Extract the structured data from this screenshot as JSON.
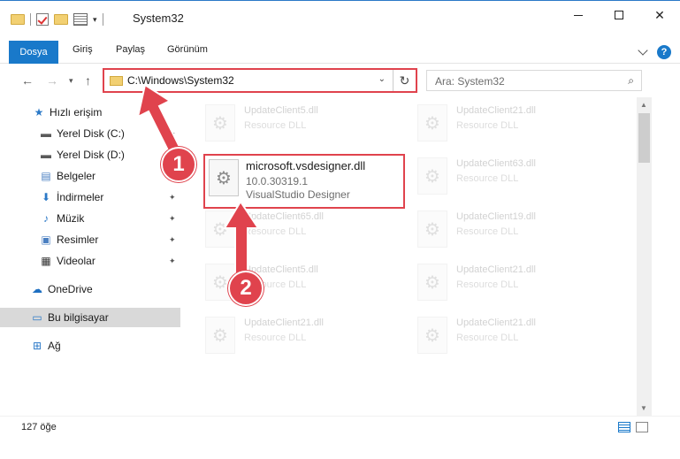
{
  "window": {
    "title": "System32",
    "minimize": "",
    "maximize": "",
    "close": "✕"
  },
  "ribbon": {
    "tabs": [
      "Dosya",
      "Giriş",
      "Paylaş",
      "Görünüm"
    ],
    "help": "?"
  },
  "address": {
    "path": "C:\\Windows\\System32",
    "dropdown": "⌄",
    "refresh": "↻"
  },
  "search": {
    "placeholder": "Ara: System32"
  },
  "sidebar": {
    "items": [
      {
        "label": "Hızlı erişim",
        "icon": "star-icon",
        "glyph": "★",
        "color": "#2b79c7"
      },
      {
        "label": "Yerel Disk (C:)",
        "icon": "drive-c-icon",
        "glyph": "▬",
        "color": "#5a5a5a",
        "pinned": true
      },
      {
        "label": "Yerel Disk (D:)",
        "icon": "drive-d-icon",
        "glyph": "▬",
        "color": "#5a5a5a",
        "pinned": true
      },
      {
        "label": "Belgeler",
        "icon": "documents-icon",
        "glyph": "▤",
        "color": "#4a7fc1",
        "pinned": true
      },
      {
        "label": "İndirmeler",
        "icon": "downloads-icon",
        "glyph": "⬇",
        "color": "#2b79c7",
        "pinned": true
      },
      {
        "label": "Müzik",
        "icon": "music-icon",
        "glyph": "♪",
        "color": "#2b79c7",
        "pinned": true
      },
      {
        "label": "Resimler",
        "icon": "pictures-icon",
        "glyph": "▣",
        "color": "#4a7fc1",
        "pinned": true
      },
      {
        "label": "Videolar",
        "icon": "videos-icon",
        "glyph": "▦",
        "color": "#333333",
        "pinned": true
      },
      {
        "label": "OneDrive",
        "icon": "onedrive-icon",
        "glyph": "☁",
        "color": "#1e6fc1"
      },
      {
        "label": "Bu bilgisayar",
        "icon": "this-pc-icon",
        "glyph": "▭",
        "color": "#2b79c7",
        "selected": true
      },
      {
        "label": "Ağ",
        "icon": "network-icon",
        "glyph": "⊞",
        "color": "#2b79c7"
      }
    ],
    "pin_glyph": "📌"
  },
  "files": [
    {
      "name": "UpdateClient5.dll",
      "desc": "Resource DLL"
    },
    {
      "name": "UpdateClient21.dll",
      "desc": "Resource DLL"
    },
    {
      "name": "microsoft.vsdesigner.dll",
      "version": "10.0.30319.1",
      "desc": "VisualStudio Designer",
      "highlight": true
    },
    {
      "name": "UpdateClient63.dll",
      "desc": "Resource DLL"
    },
    {
      "name": "UpdateClient65.dll",
      "desc": "Resource DLL"
    },
    {
      "name": "UpdateClient19.dll",
      "desc": "Resource DLL"
    },
    {
      "name": "UpdateClient5.dll",
      "desc": "Resource DLL"
    },
    {
      "name": "UpdateClient21.dll",
      "desc": "Resource DLL"
    },
    {
      "name": "UpdateClient21.dll",
      "desc": "Resource DLL"
    },
    {
      "name": "UpdateClient21.dll",
      "desc": "Resource DLL"
    }
  ],
  "status": {
    "count": "127 öğe"
  },
  "annotations": {
    "step1": "1",
    "step2": "2",
    "color": "#e0434d"
  }
}
